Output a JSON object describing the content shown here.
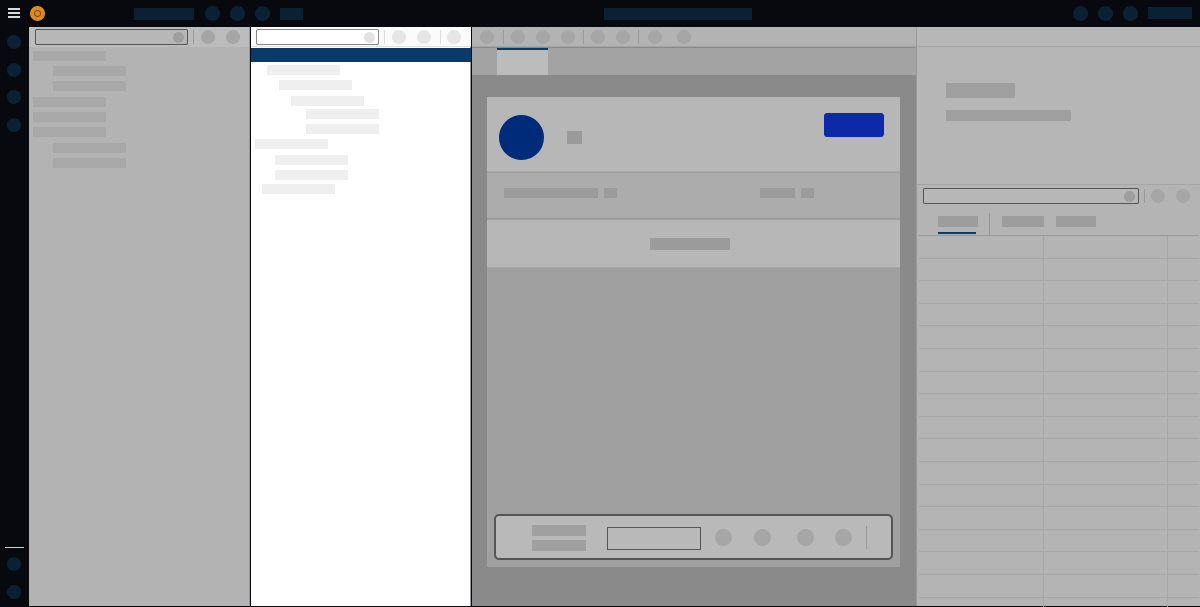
{
  "colors": {
    "topbar_bg": "#08090f",
    "accent_navy": "#0a2033",
    "brand_orange": "#e08a1e",
    "tree_selected": "#0b3a66",
    "avatar_blue": "#002a7a",
    "primary_button": "#0a2aa8",
    "tab_underline": "#0b3a66"
  },
  "topbar": {
    "menu_icon": "hamburger-menu-icon",
    "logo_icon": "orange-logo-icon",
    "left_icons": [
      "circle-icon",
      "circle-icon",
      "circle-icon"
    ],
    "right_icons": [
      "circle-icon",
      "circle-icon",
      "circle-icon"
    ]
  },
  "rail": {
    "icons": [
      "circle-icon",
      "circle-icon",
      "circle-icon",
      "circle-icon"
    ],
    "bottom_icons": [
      "circle-icon",
      "circle-icon"
    ]
  },
  "left_panel": {
    "search_icon": "search-icon",
    "tool_icons": [
      "circle-icon",
      "circle-icon"
    ],
    "item_count": 8
  },
  "tree_panel": {
    "search_icon": "search-icon",
    "tool_icons": [
      "circle-icon",
      "circle-icon",
      "circle-icon"
    ]
  },
  "main": {
    "tool_icons": [
      "circle-icon",
      "circle-icon",
      "circle-icon",
      "circle-icon",
      "circle-icon",
      "circle-icon",
      "circle-icon",
      "circle-icon"
    ]
  },
  "right_panel": {
    "search_icon": "search-icon",
    "tool_icons": [
      "circle-icon",
      "circle-icon"
    ],
    "table_rows": 16
  }
}
